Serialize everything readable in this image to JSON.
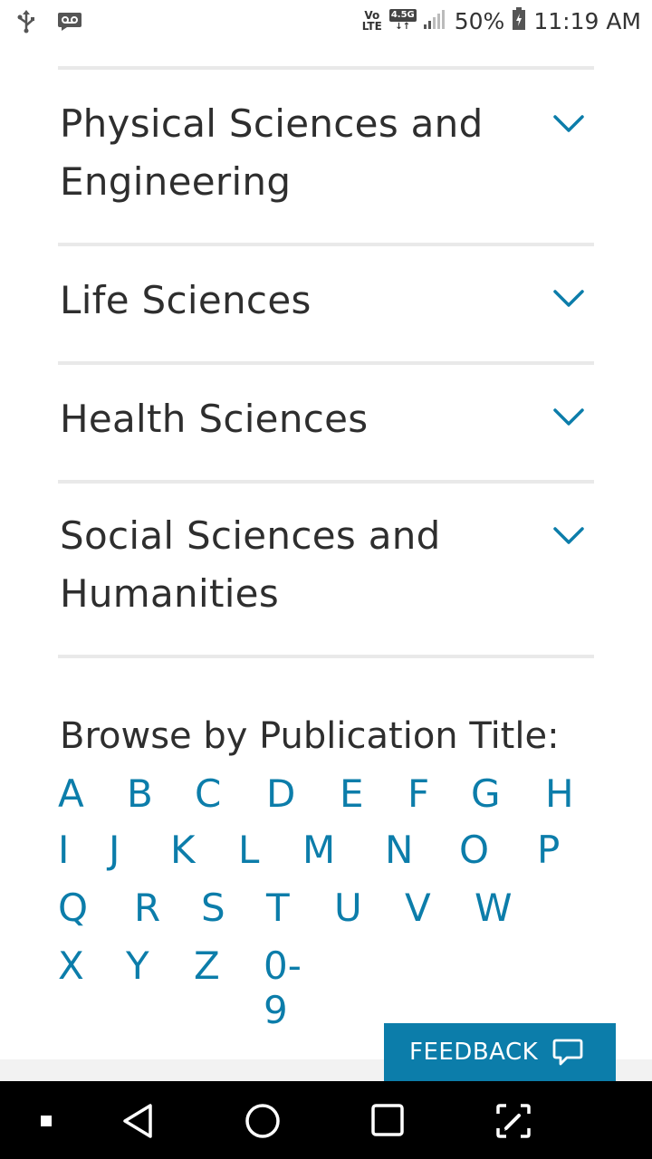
{
  "status_bar": {
    "volte_top": "Vo",
    "volte_bottom": "LTE",
    "network_badge": "4.5G",
    "battery_percent": "50%",
    "time": "11:19 AM",
    "icons": [
      "usb-icon",
      "voicemail-icon",
      "signal-icon",
      "battery-icon"
    ]
  },
  "accordion": {
    "items": [
      {
        "label_line1": "Physical Sciences and",
        "label_line2": "Engineering"
      },
      {
        "label_line1": "Life Sciences",
        "label_line2": ""
      },
      {
        "label_line1": "Health Sciences",
        "label_line2": ""
      },
      {
        "label_line1": "Social Sciences and",
        "label_line2": "Humanities"
      }
    ],
    "chevron_icon": "chevron-down-icon"
  },
  "browse": {
    "title": "Browse by Publication Title:",
    "rows": [
      [
        "A",
        "B",
        "C",
        "D",
        "E",
        "F",
        "G",
        "H"
      ],
      [
        "I",
        "J",
        "K",
        "L",
        "M",
        "N",
        "O",
        "P"
      ],
      [
        "Q",
        "R",
        "S",
        "T",
        "U",
        "V",
        "W"
      ],
      [
        "X",
        "Y",
        "Z",
        "0-9"
      ]
    ]
  },
  "feedback": {
    "label": "FEEDBACK",
    "icon": "chat-bubble-icon"
  },
  "nav_bar": {
    "icons": [
      "recents-dot-icon",
      "back-icon",
      "home-icon",
      "overview-icon",
      "screenshot-edit-icon"
    ]
  },
  "colors": {
    "accent": "#0c7daa",
    "text": "#2e2e2e",
    "divider": "#e9e9e9"
  }
}
